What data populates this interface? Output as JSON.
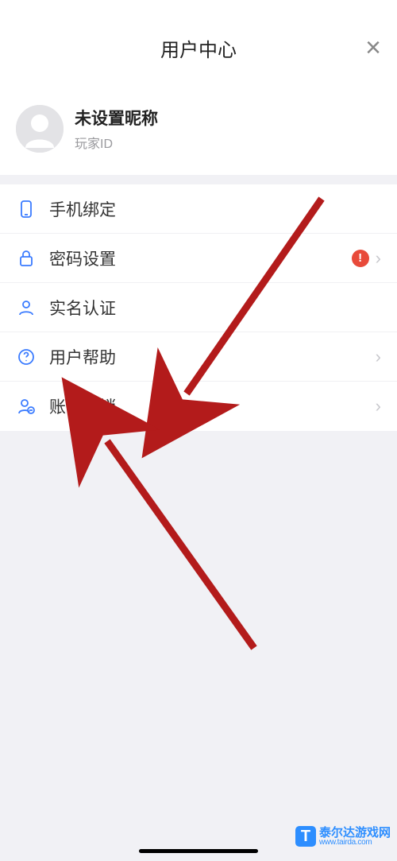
{
  "header": {
    "title": "用户中心",
    "close": "×"
  },
  "profile": {
    "nickname": "未设置昵称",
    "player_id_label": "玩家ID"
  },
  "menu": {
    "phone_bind": "手机绑定",
    "password": "密码设置",
    "realname": "实名认证",
    "help": "用户帮助",
    "deactivate": "账号注销",
    "alert": "!"
  },
  "watermark": {
    "badge": "T",
    "name": "泰尔达游戏网",
    "url": "www.tairda.com"
  }
}
